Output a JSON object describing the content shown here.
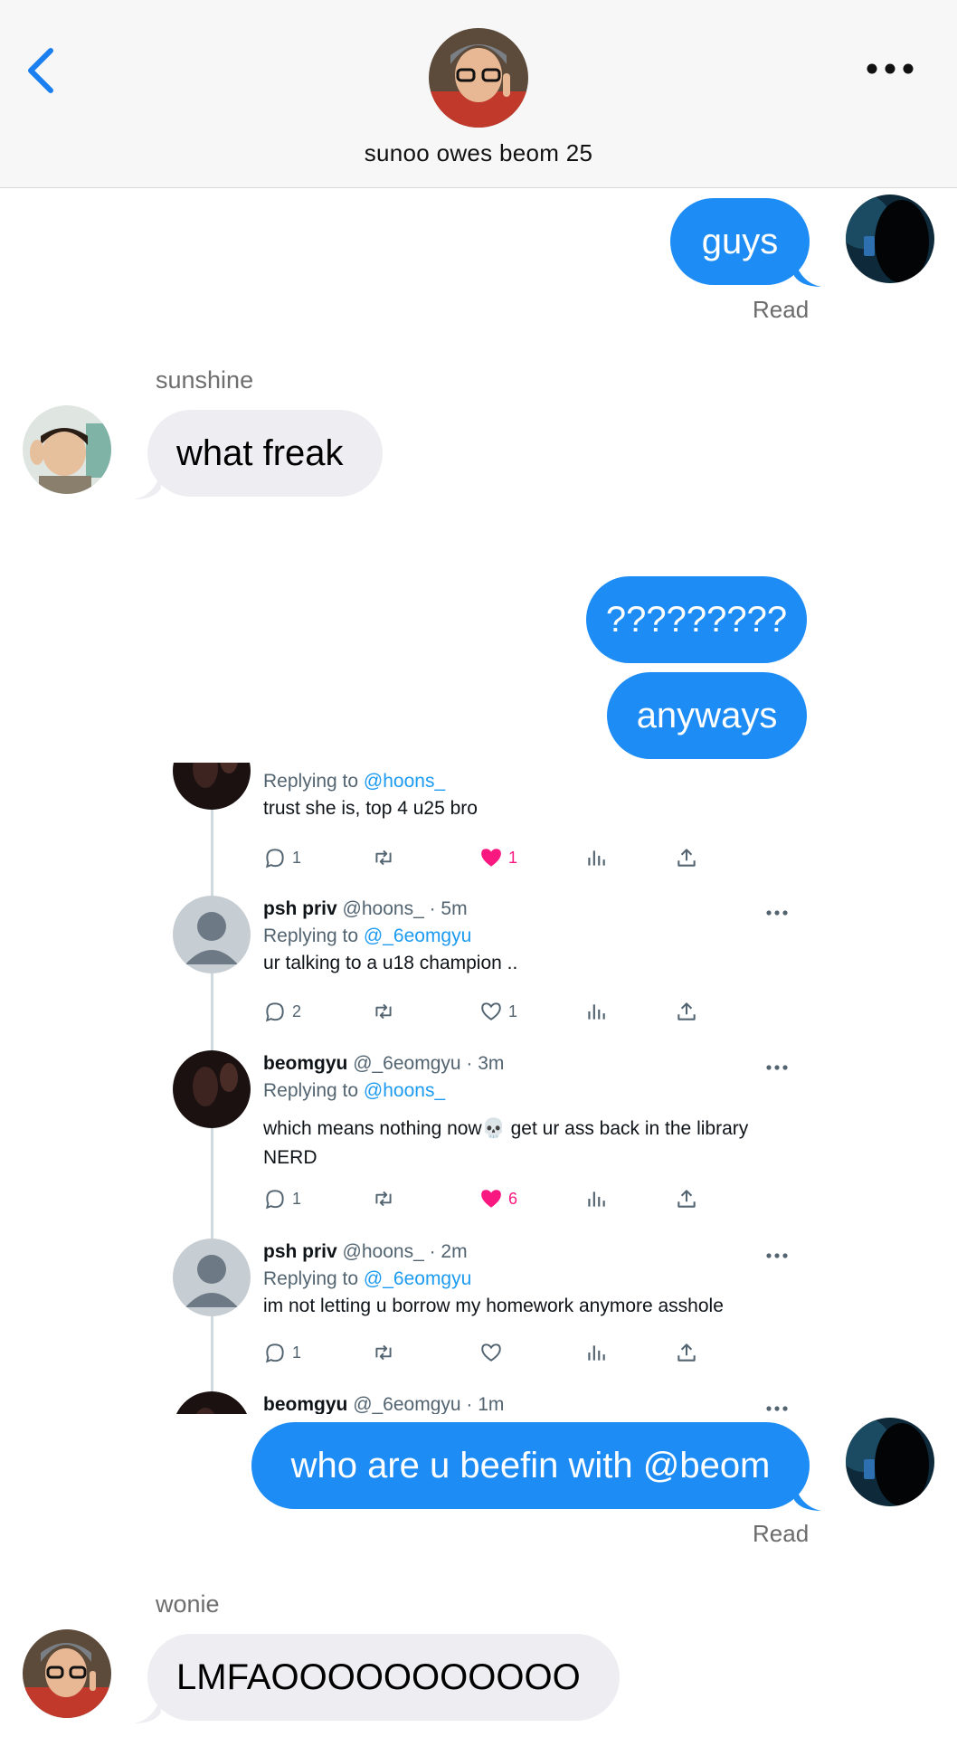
{
  "header": {
    "group_name": "sunoo owes beom 25",
    "back_icon": "chevron-left-icon",
    "more_icon": "ellipsis-icon"
  },
  "messages": [
    {
      "from": "me",
      "text": "guys",
      "status": "Read"
    },
    {
      "from": "sunshine",
      "sender": "sunshine",
      "text": "what freak"
    },
    {
      "from": "me",
      "text": "?????????"
    },
    {
      "from": "me",
      "text": "anyways"
    },
    {
      "from": "me",
      "text": "who are u beefin with @beom",
      "status": "Read"
    },
    {
      "from": "wonie",
      "sender": "wonie",
      "text": "LMFAOOOOOOOOOOO"
    }
  ],
  "tweet_screenshot": {
    "tweets": [
      {
        "name": "",
        "handle": "",
        "time": "",
        "replying_prefix": "Replying to ",
        "replying_to": "@hoons_",
        "body": "trust she is, top 4 u25 bro",
        "replies": "1",
        "liked": true,
        "likes": "1"
      },
      {
        "name": "psh priv",
        "handle": "@hoons_ · 5m",
        "replying_prefix": "Replying to ",
        "replying_to": "@_6eomgyu",
        "body": "ur talking to a u18 champion ..",
        "replies": "2",
        "liked": false,
        "likes": "1"
      },
      {
        "name": "beomgyu",
        "handle": "@_6eomgyu · 3m",
        "replying_prefix": "Replying to ",
        "replying_to": "@hoons_",
        "body": "which means nothing now💀 get ur ass back in the library NERD",
        "replies": "1",
        "liked": true,
        "likes": "6"
      },
      {
        "name": "psh priv",
        "handle": "@hoons_ · 2m",
        "replying_prefix": "Replying to ",
        "replying_to": "@_6eomgyu",
        "body": "im not letting u borrow my homework anymore asshole",
        "replies": "1",
        "liked": false,
        "likes": ""
      },
      {
        "name": "beomgyu",
        "handle": "@_6eomgyu · 1m"
      }
    ]
  },
  "colors": {
    "imessage_blue": "#1d8cf5",
    "received_bubble": "#eeeef2",
    "twitter_link": "#1d9bf0",
    "like_pink": "#f91880"
  }
}
